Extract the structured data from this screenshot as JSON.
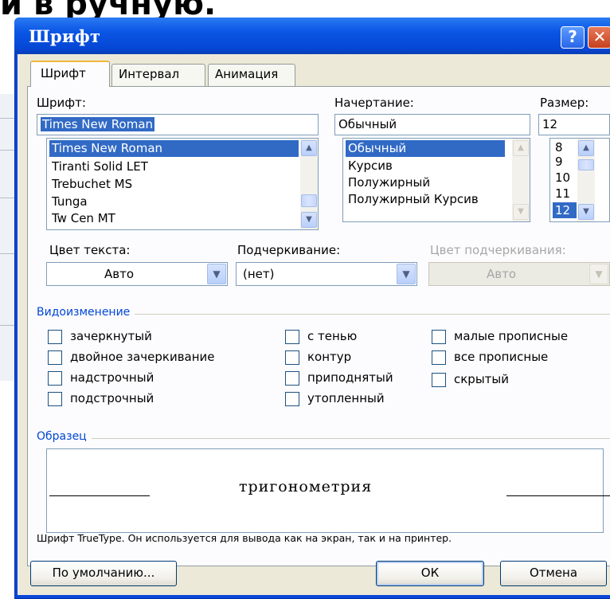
{
  "background": {
    "title_fragment": "и в ручную."
  },
  "window": {
    "title": "Шрифт",
    "help_glyph": "?",
    "close_glyph": "✕"
  },
  "tabs": [
    {
      "label": "Шрифт",
      "active": true
    },
    {
      "label": "Интервал",
      "active": false
    },
    {
      "label": "Анимация",
      "active": false
    }
  ],
  "font": {
    "label": "Шрифт:",
    "value": "Times New Roman",
    "list": [
      "Times New Roman",
      "Tiranti Solid LET",
      "Trebuchet MS",
      "Tunga",
      "Tw Cen MT"
    ],
    "selected_index": 0
  },
  "style": {
    "label": "Начертание:",
    "value": "Обычный",
    "list": [
      "Обычный",
      "Курсив",
      "Полужирный",
      "Полужирный Курсив"
    ],
    "selected_index": 0
  },
  "size": {
    "label": "Размер:",
    "value": "12",
    "list": [
      "8",
      "9",
      "10",
      "11",
      "12"
    ],
    "selected_index": 4
  },
  "text_color": {
    "label": "Цвет текста:",
    "value": "Авто"
  },
  "underline": {
    "label": "Подчеркивание:",
    "value": "(нет)"
  },
  "underline_color": {
    "label": "Цвет подчеркивания:",
    "value": "Авто",
    "disabled": true
  },
  "effects": {
    "title": "Видоизменение",
    "col1": [
      "зачеркнутый",
      "двойное зачеркивание",
      "надстрочный",
      "подстрочный"
    ],
    "col2": [
      "с тенью",
      "контур",
      "приподнятый",
      "утопленный"
    ],
    "col3": [
      "малые прописные",
      "все прописные",
      "скрытый"
    ]
  },
  "sample": {
    "title": "Образец",
    "text": "тригонометрия",
    "note": "Шрифт TrueType. Он используется для вывода как на экран, так и на принтер."
  },
  "buttons": {
    "default": "По умолчанию...",
    "ok": "ОК",
    "cancel": "Отмена"
  },
  "icons": {
    "scroll_up": "up-arrow-icon",
    "scroll_down": "down-arrow-icon",
    "dropdown": "chevron-down-icon"
  },
  "colors": {
    "titlebar": "#0a55e4",
    "selection": "#316ac5",
    "group_title": "#0046d5",
    "dialog_bg": "#ece9d8"
  }
}
